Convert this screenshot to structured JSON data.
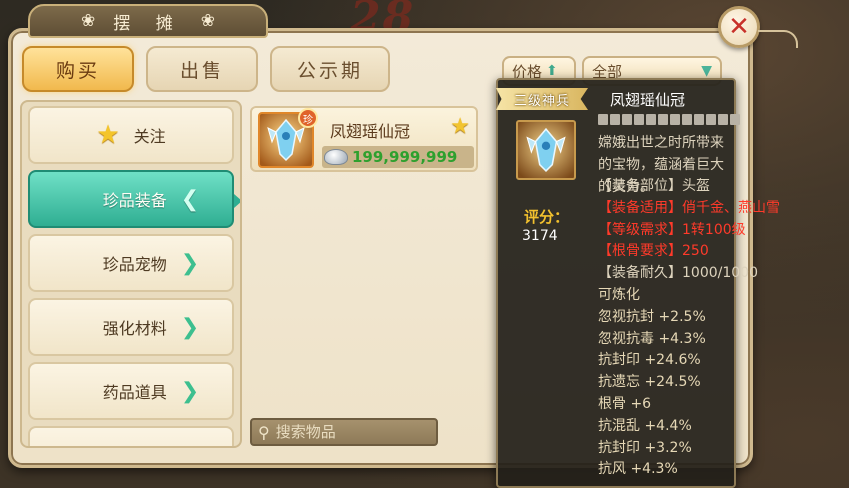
{
  "background": {
    "number_text": "28"
  },
  "window": {
    "title": "摆 摊",
    "close_icon": "close-icon"
  },
  "tabs": [
    {
      "label": "购买",
      "active": true
    },
    {
      "label": "出售",
      "active": false
    },
    {
      "label": "公示期",
      "active": false
    }
  ],
  "controls": {
    "sort_label": "价格",
    "sort_icon": "arrow-up-icon",
    "filter_value": "全部",
    "filter_icon": "chevron-down-icon"
  },
  "categories": [
    {
      "label": "关注",
      "icon": "star-icon"
    },
    {
      "label": "珍品装备",
      "icon": "chevron-left-icon",
      "active": true,
      "arrow": "❮"
    },
    {
      "label": "珍品宠物",
      "icon": "chevron-right-icon",
      "arrow": "❯"
    },
    {
      "label": "强化材料",
      "icon": "chevron-right-icon",
      "arrow": "❯"
    },
    {
      "label": "药品道具",
      "icon": "chevron-right-icon",
      "arrow": "❯"
    }
  ],
  "items": [
    {
      "name": "凤翅瑶仙冠",
      "badge": "珍",
      "price": "199,999,999",
      "currency_icon": "silver-ingot-icon",
      "favorite_icon": "star-icon"
    }
  ],
  "search": {
    "placeholder": "搜索物品"
  },
  "tooltip": {
    "tier": "三级神兵",
    "name": "凤翅瑶仙冠",
    "description": "嫦娥出世之时所带来的宝物，蕴涵着巨大的灵力。",
    "score_label": "评分：",
    "score_value": "3174",
    "lines": [
      {
        "text": "【装备部位】头盔",
        "color": "normal"
      },
      {
        "text": "【装备适用】俏千金、燕山雪",
        "color": "red"
      },
      {
        "text": "【等级需求】1转100级",
        "color": "red"
      },
      {
        "text": "【根骨要求】250",
        "color": "red"
      },
      {
        "text": "【装备耐久】1000/1000",
        "color": "normal"
      },
      {
        "text": "可炼化",
        "color": "beige"
      },
      {
        "text": "忽视抗封 +2.5%",
        "color": "beige"
      },
      {
        "text": "忽视抗毒 +4.3%",
        "color": "beige"
      },
      {
        "text": "抗封印 +24.6%",
        "color": "beige"
      },
      {
        "text": "抗遗忘 +24.5%",
        "color": "beige"
      },
      {
        "text": "根骨 +6",
        "color": "beige"
      },
      {
        "text": "抗混乱 +4.4%",
        "color": "beige"
      },
      {
        "text": "抗封印 +3.2%",
        "color": "beige"
      },
      {
        "text": "抗风 +4.3%",
        "color": "beige"
      }
    ]
  },
  "colors": {
    "accent_teal": "#2fae92",
    "tab_gold": "#f1b94d",
    "price_green": "#2ea02e",
    "requirement_red": "#ff3a2a",
    "score_gold": "#f2c12e"
  }
}
